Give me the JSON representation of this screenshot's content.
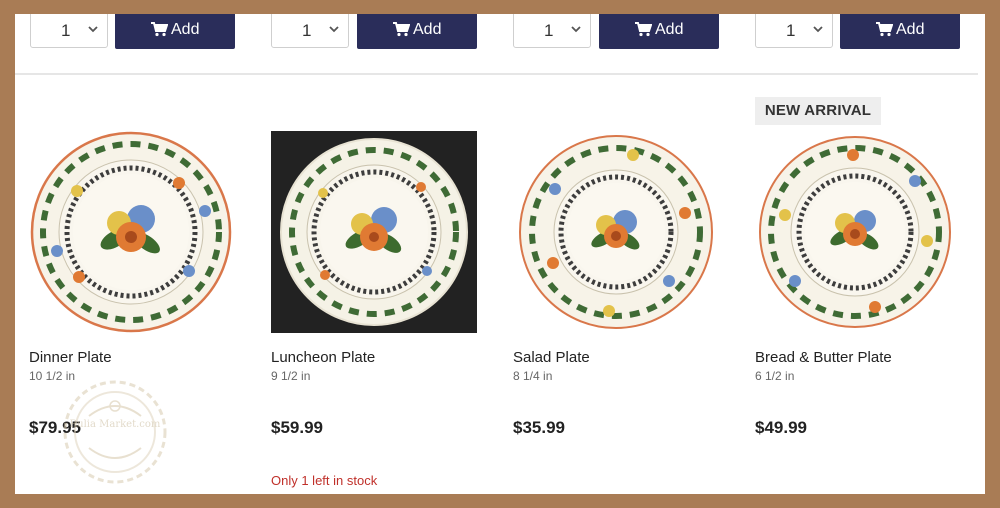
{
  "top_row": {
    "items": [
      {
        "quantity": "1",
        "add_label": "Add"
      },
      {
        "quantity": "1",
        "add_label": "Add"
      },
      {
        "quantity": "1",
        "add_label": "Add"
      },
      {
        "quantity": "1",
        "add_label": "Add"
      }
    ]
  },
  "products": [
    {
      "name": "Dinner Plate",
      "size": "10 1/2 in",
      "price": "$79.95",
      "badge": "",
      "stock_note": ""
    },
    {
      "name": "Luncheon Plate",
      "size": "9 1/2 in",
      "price": "$59.99",
      "badge": "",
      "stock_note": "Only 1 left in stock"
    },
    {
      "name": "Salad Plate",
      "size": "8 1/4 in",
      "price": "$35.99",
      "badge": "",
      "stock_note": ""
    },
    {
      "name": "Bread & Butter Plate",
      "size": "6 1/2 in",
      "price": "$49.99",
      "badge": "NEW ARRIVAL",
      "stock_note": ""
    }
  ],
  "watermark": {
    "text": "Rulia Market.com"
  },
  "colors": {
    "frame": "#a97c55",
    "button": "#2a2d5a",
    "stock_warning": "#c0302a"
  },
  "icons": {
    "add_button": "cart-icon",
    "quantity_select": "chevron-down-icon"
  }
}
